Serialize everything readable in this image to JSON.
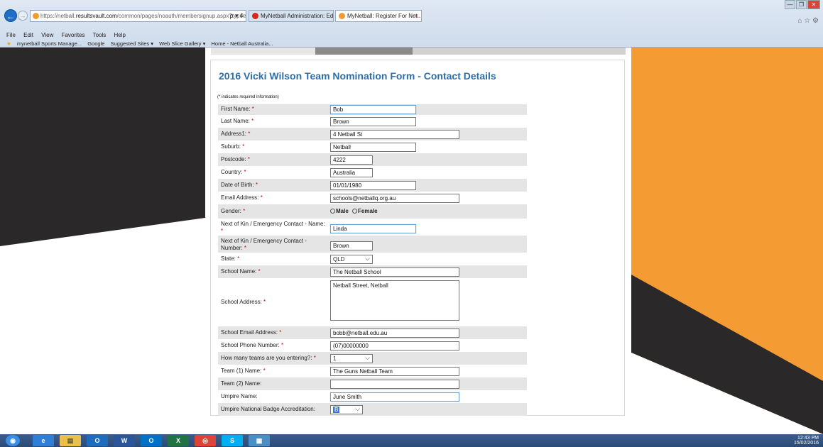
{
  "browser": {
    "url_prefix": "https://netball.",
    "url_domain": "resultsvault.com",
    "url_path": "/common/pages/noauth/membersignup.aspx?typeeBfc",
    "url_tools": "ρ ▾ ¢",
    "tabs": [
      {
        "label": "MyNetball Administration: Edi...",
        "active": false,
        "color": "#d9261c"
      },
      {
        "label": "MyNetball: Register For Net...",
        "active": true,
        "color": "#f39b33"
      }
    ],
    "tab_close": "×",
    "menu": [
      "File",
      "Edit",
      "View",
      "Favorites",
      "Tools",
      "Help"
    ],
    "favorites": [
      "mynetball Sports Manage...",
      "Google",
      "Suggested Sites ▾",
      "Web Slice Gallery ▾",
      "Home - Netball Australia..."
    ],
    "window_controls": [
      "—",
      "❐",
      "✕"
    ],
    "top_icons": "⌂ ☆ ⚙"
  },
  "form": {
    "title": "2016 Vicki Wilson Team Nomination Form - Contact Details",
    "required_note": "(* indicates required information)",
    "required_marker": "*",
    "fields": {
      "first_name": {
        "label": "First Name:",
        "value": "Bob"
      },
      "last_name": {
        "label": "Last Name:",
        "value": "Brown"
      },
      "address1": {
        "label": "Address1:",
        "value": "4 Netball St"
      },
      "suburb": {
        "label": "Suburb:",
        "value": "Netball"
      },
      "postcode": {
        "label": "Postcode:",
        "value": "4222"
      },
      "country": {
        "label": "Country:",
        "value": "Australia"
      },
      "dob": {
        "label": "Date of Birth:",
        "value": "01/01/1980"
      },
      "email": {
        "label": "Email Address:",
        "value": "schools@netballq.org.au"
      },
      "gender": {
        "label": "Gender:",
        "option_male": "Male",
        "option_female": "Female"
      },
      "nok_name": {
        "label": "Next of Kin / Emergency Contact - Name:",
        "value": "Linda"
      },
      "nok_number": {
        "label": "Next of Kin / Emergency Contact - Number:",
        "value": "Brown"
      },
      "state": {
        "label": "State:",
        "value": "QLD"
      },
      "school_name": {
        "label": "School Name:",
        "value": "The Netball School"
      },
      "school_address": {
        "label": "School Address:",
        "value": "Netball Street, Netball"
      },
      "school_email": {
        "label": "School Email Address:",
        "value": "bobb@netball.edu.au"
      },
      "school_phone": {
        "label": "School Phone Number:",
        "value": "(07)00000000"
      },
      "teams_count": {
        "label": "How many teams are you entering?:",
        "value": "1"
      },
      "team1": {
        "label": "Team (1) Name:",
        "value": "The Guns Netball Team"
      },
      "team2": {
        "label": "Team (2) Name:",
        "value": ""
      },
      "umpire_name": {
        "label": "Umpire Name:",
        "value": "June Smith"
      },
      "umpire_badge": {
        "label": "Umpire National Badge Accreditation:",
        "value": "B"
      }
    }
  },
  "taskbar": {
    "apps": [
      {
        "name": "start",
        "glyph": "◉",
        "color": "#3a8ee6"
      },
      {
        "name": "ie",
        "glyph": "e",
        "color": "#2f7fd6"
      },
      {
        "name": "explorer",
        "glyph": "▤",
        "color": "#e8c04a"
      },
      {
        "name": "outlook",
        "glyph": "O",
        "color": "#1f6bbd"
      },
      {
        "name": "word",
        "glyph": "W",
        "color": "#2b579a"
      },
      {
        "name": "outlook2",
        "glyph": "O",
        "color": "#0072c6"
      },
      {
        "name": "excel",
        "glyph": "X",
        "color": "#217346"
      },
      {
        "name": "chrome",
        "glyph": "◎",
        "color": "#db4437"
      },
      {
        "name": "skype",
        "glyph": "S",
        "color": "#00aff0"
      },
      {
        "name": "photos",
        "glyph": "▦",
        "color": "#4a8fc6"
      }
    ],
    "time": "12:43 PM",
    "date": "15/02/2016"
  },
  "colors": {
    "title": "#2e6ea6",
    "orange": "#f59b34",
    "dark": "#2a2828",
    "required": "#cc0000"
  }
}
